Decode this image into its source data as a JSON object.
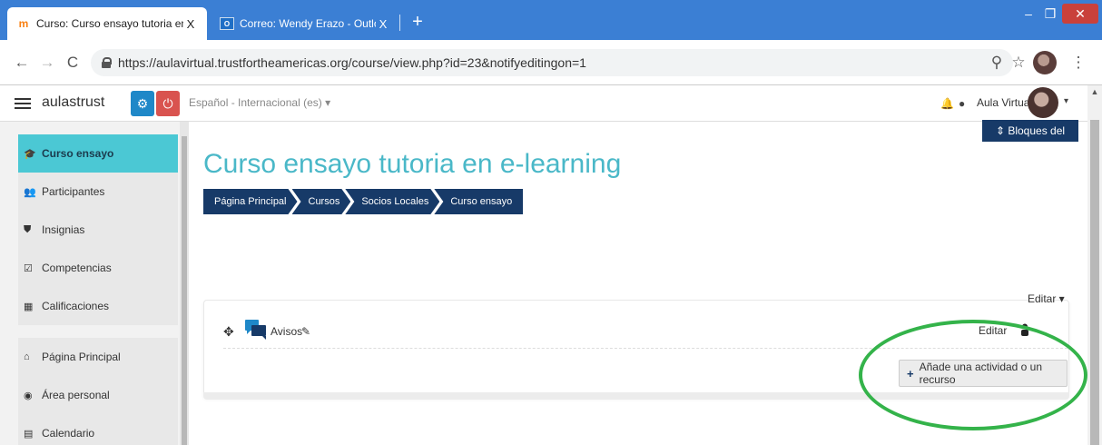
{
  "browser": {
    "tabs": [
      {
        "favicon": "moodle-m-icon",
        "title": "Curso: Curso ensayo tutoria en e",
        "close": "X",
        "active": true
      },
      {
        "favicon": "outlook-icon",
        "title": "Correo: Wendy Erazo - Outlook",
        "close": "X",
        "active": false
      }
    ],
    "newtab": "+",
    "window_controls": {
      "minimize": "–",
      "maximize": "❐",
      "close": "✕"
    },
    "nav": {
      "back": "←",
      "forward": "→",
      "reload": "C"
    },
    "url": "https://aulavirtual.trustfortheamericas.org/course/view.php?id=23&notifyeditingon=1",
    "omnibox_icons": {
      "search": "⚲",
      "bookmark": "☆",
      "menu": "⋮"
    }
  },
  "navbar": {
    "site_name": "aulastrust",
    "gear": "⚙",
    "power": "⏻",
    "language": "Español - Internacional (es) ▾",
    "bell": "🔔",
    "chat": "●",
    "user_name": "Aula Virtual",
    "caret": "▾"
  },
  "drawer": {
    "course_items": [
      {
        "icon": "graduation-cap-icon",
        "glyph": "🎓",
        "label": "Curso ensayo",
        "active": true
      },
      {
        "icon": "users-icon",
        "glyph": "👥",
        "label": "Participantes"
      },
      {
        "icon": "shield-icon",
        "glyph": "⛊",
        "label": "Insignias"
      },
      {
        "icon": "checkbox-icon",
        "glyph": "☑",
        "label": "Competencias"
      },
      {
        "icon": "table-icon",
        "glyph": "▦",
        "label": "Calificaciones"
      }
    ],
    "site_items": [
      {
        "icon": "home-icon",
        "glyph": "⌂",
        "label": "Página Principal"
      },
      {
        "icon": "dashboard-icon",
        "glyph": "◉",
        "label": "Área personal"
      },
      {
        "icon": "calendar-icon",
        "glyph": "▤",
        "label": "Calendario"
      }
    ]
  },
  "main": {
    "blocks_button": "⇕ Bloques del Curso",
    "title": "Curso ensayo tutoria en e-learning",
    "breadcrumb": [
      "Página Principal",
      "Cursos",
      "Socios Locales",
      "Curso ensayo"
    ],
    "section_edit": "Editar ▾",
    "activity": {
      "move": "✥",
      "name": "Avisos",
      "pencil": "✎",
      "edit": "Editar"
    },
    "add_activity": {
      "plus": "+",
      "label": "Añade una actividad o un recurso"
    }
  },
  "colors": {
    "accent": "#4ab8c8",
    "navy": "#173a68",
    "highlight_oval": "#34b34a",
    "chrome_blue": "#3b7fd4"
  }
}
